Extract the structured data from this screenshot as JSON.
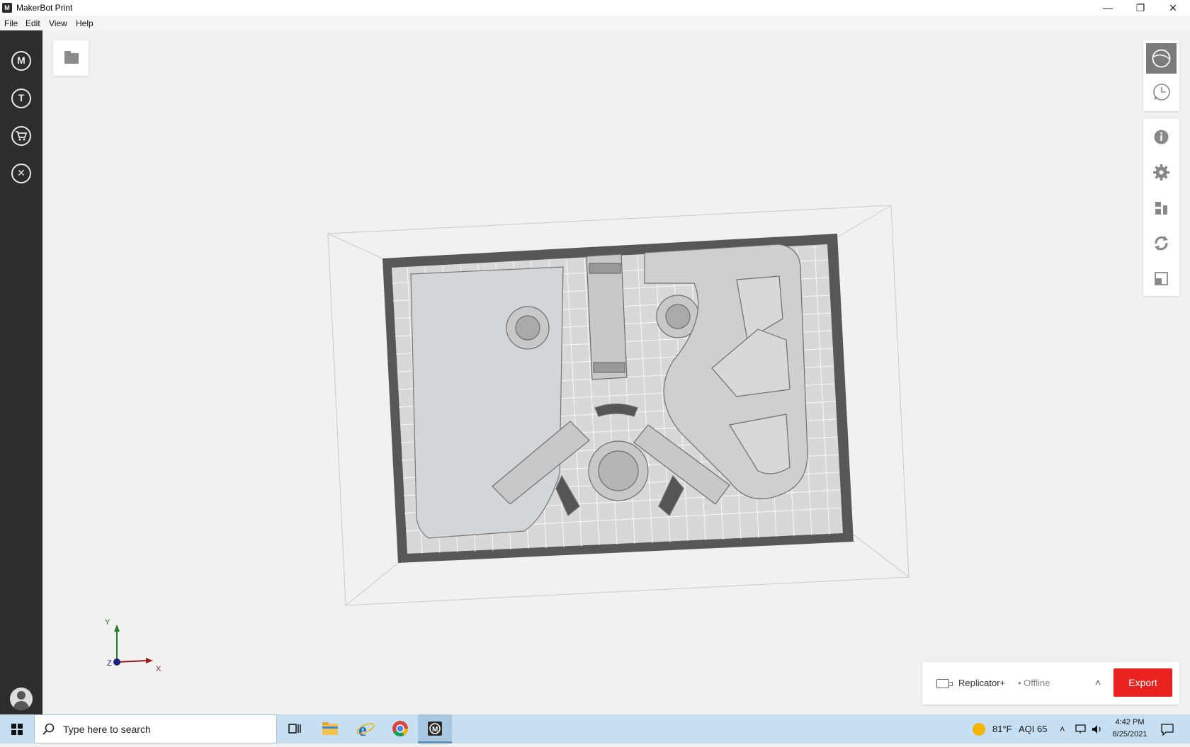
{
  "window": {
    "title": "MakerBot Print",
    "controls": {
      "minimize": "—",
      "restore": "❐",
      "close": "✕"
    }
  },
  "menu": {
    "file": "File",
    "edit": "Edit",
    "view": "View",
    "help": "Help"
  },
  "left_nav": {
    "items": [
      {
        "name": "makerbot-home",
        "glyph": "M"
      },
      {
        "name": "thingiverse",
        "glyph": "T"
      },
      {
        "name": "store",
        "glyph": "▤"
      },
      {
        "name": "tools",
        "glyph": "✕"
      }
    ]
  },
  "axes": {
    "x": "X",
    "y": "Y",
    "z": "Z"
  },
  "printer": {
    "name": "Replicator+",
    "status": "• Offline",
    "caret": "˄"
  },
  "export_label": "Export",
  "taskbar": {
    "search_placeholder": "Type here to search",
    "weather_temp": "81°F",
    "aqi": "AQI 65",
    "time": "4:42 PM",
    "date": "8/25/2021"
  }
}
